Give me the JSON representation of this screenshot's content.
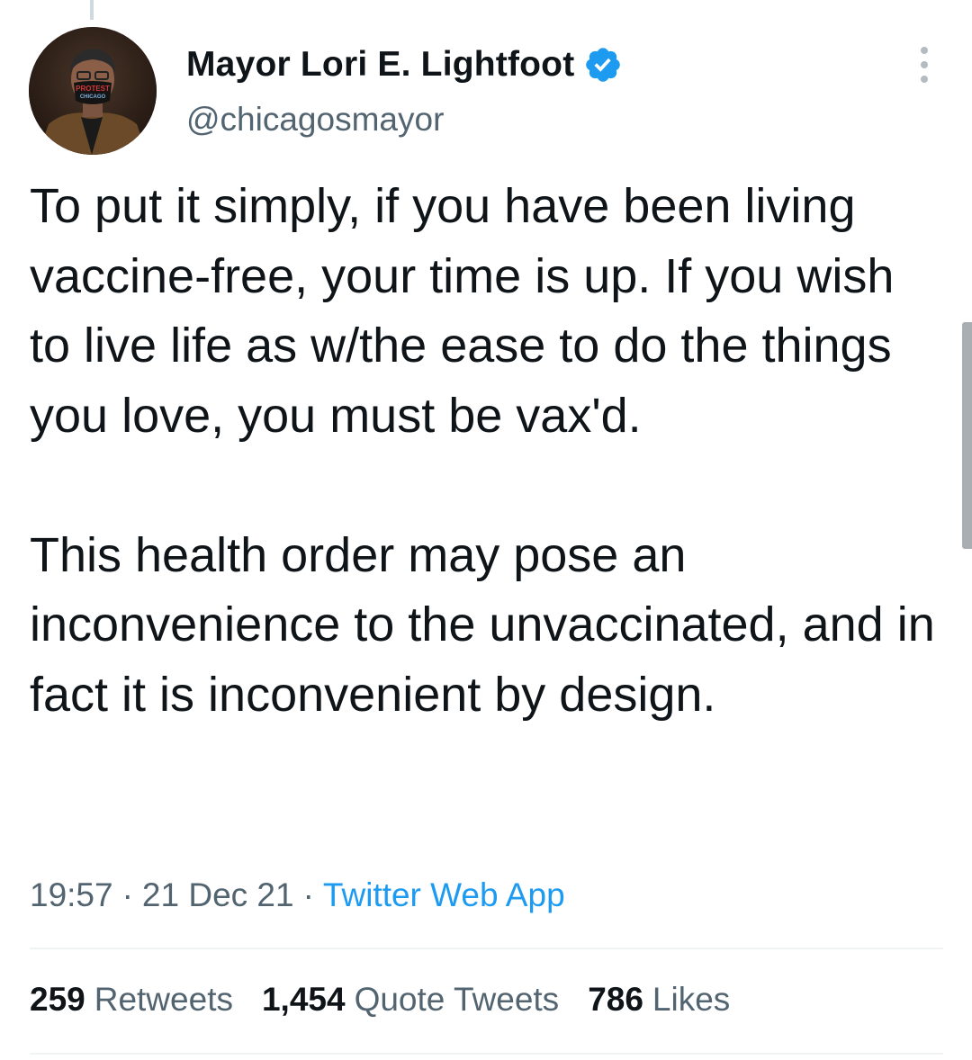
{
  "tweet": {
    "author": {
      "display_name": "Mayor Lori E. Lightfoot",
      "handle": "@chicagosmayor",
      "verified": true,
      "avatar_mask_text": "PROTEST CHICAGO"
    },
    "text": "To put it simply, if you have been living vaccine-free, your time is up. If you wish to live life as w/the ease to do the things you love, you must be vax'd.\n\nThis health order may pose an inconvenience to the unvaccinated, and in fact it is inconvenient by design.",
    "time": "19:57",
    "date": "21 Dec 21",
    "separator": "·",
    "source": "Twitter Web App",
    "stats": {
      "retweets": {
        "count": "259",
        "label": "Retweets"
      },
      "quote_tweets": {
        "count": "1,454",
        "label": "Quote Tweets"
      },
      "likes": {
        "count": "786",
        "label": "Likes"
      }
    }
  },
  "icons": {
    "verified": "verified-badge-icon",
    "more": "more-options-icon"
  },
  "colors": {
    "text_primary": "#0f1419",
    "text_secondary": "#536471",
    "accent": "#1d9bf0",
    "divider": "#eff3f4"
  }
}
